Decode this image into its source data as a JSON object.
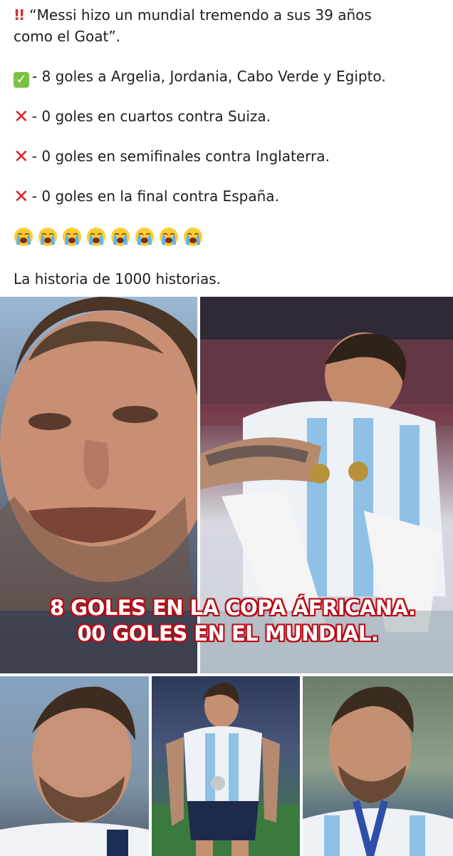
{
  "post": {
    "line1_a": "“Messi hizo un mundial tremendo a sus 39 años",
    "line1_b": "como el Goat”.",
    "line2": "- 8 goles a Argelia, Jordania, Cabo Verde y Egipto.",
    "line3": "- 0 goles en cuartos contra Suiza.",
    "line4": "- 0 goles en semifinales contra Inglaterra.",
    "line5": "- 0 goles en la final contra España.",
    "closing": "La historia de 1000 historias.",
    "crying_emoji_count": 8,
    "icons": {
      "line1": "double-exclamation-icon",
      "line2": "check-mark-icon",
      "line3": "cross-mark-icon",
      "line4": "cross-mark-icon",
      "line5": "cross-mark-icon",
      "emoji_row": "loudly-crying-face-icon"
    }
  },
  "image": {
    "caption_line1": "8 GOLES EN LA COPA ÁFRICANA.",
    "caption_line2": "00 GOLES EN EL MUNDIAL."
  },
  "colors": {
    "text": "#1c1e21",
    "check": "#7cc242",
    "cross": "#e0262b",
    "caption_outline": "#c0101a"
  }
}
